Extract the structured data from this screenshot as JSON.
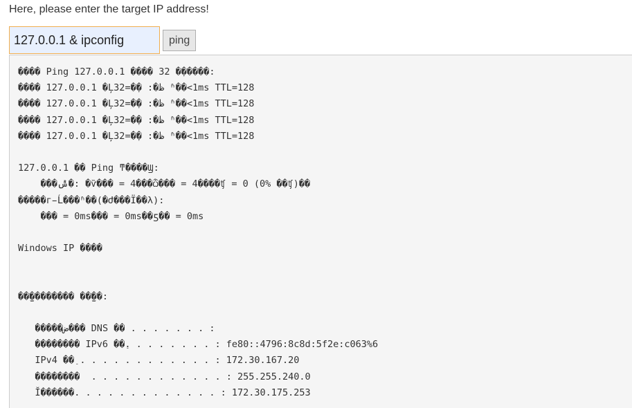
{
  "prompt": {
    "text": "Here, please enter the target IP address!"
  },
  "form": {
    "ip_value": "127.0.0.1 & ipconfig",
    "button_label": "ping"
  },
  "output": {
    "lines": [
      "���� Ping 127.0.0.1 ���� 32 �ֽ�����:",
      "���� 127.0.0.1 �Ļظ�: �ֽ�=32 ʱ��<1ms TTL=128",
      "���� 127.0.0.1 �Ļظ�: �ֽ�=32 ʱ��<1ms TTL=128",
      "���� 127.0.0.1 �Ļظ�: �ֽ�=32 ʱ��<1ms TTL=128",
      "���� 127.0.0.1 �Ļظ�: �ֽ�=32 ʱ��<1ms TTL=128",
      "",
      "127.0.0.1 �� Ping ͳ����Ϣ:",
      "    ���ݰ�: �ѷ��� = 4���ѽ��� = 4����ʧ = 0 (0% ��ʧ)��",
      "�����г̵Ĺ���ʱ��(�Ժ���Ϊ��λ):",
      "    ��� = 0ms��� = 0ms��ƽ�� = 0ms",
      "",
      "Windows IP ����",
      "",
      "",
      "��̫�������� ��̫��:",
      "",
      "   �����ض��� DNS ��׺ . . . . . . . :",
      "   �������� IPv6 ��ַ. . . . . . . . : fe80::4796:8c8d:5f2e:c063%6",
      "   IPv4 ��ַ . . . . . . . . . . . . : 172.30.167.20",
      "   ��������  . . . . . . . . . . . . : 255.255.240.0",
      "   Ĭ������. . . . . . . . . . . . . : 172.30.175.253"
    ]
  }
}
